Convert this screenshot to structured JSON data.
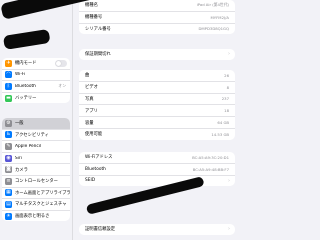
{
  "sidebar": {
    "connectivity": [
      {
        "label": "機内モード",
        "icon": "airplane-icon",
        "color": "#ff9500",
        "glyph": "✈",
        "toggle": true
      },
      {
        "label": "Wi-Fi",
        "icon": "wifi-icon",
        "color": "#007aff",
        "glyph": "◠"
      },
      {
        "label": "Bluetooth",
        "icon": "bluetooth-icon",
        "color": "#007aff",
        "glyph": "ᛒ",
        "value": "オン"
      },
      {
        "label": "バッテリー",
        "icon": "battery-icon",
        "color": "#34c759",
        "glyph": "▬"
      }
    ],
    "general": [
      {
        "label": "一般",
        "icon": "gear-icon",
        "color": "#8e8e93",
        "glyph": "⚙",
        "selected": true
      },
      {
        "label": "アクセシビリティ",
        "icon": "accessibility-icon",
        "color": "#007aff",
        "glyph": "♿"
      },
      {
        "label": "Apple Pencil",
        "icon": "pencil-icon",
        "color": "#8e8e93",
        "glyph": "✎"
      },
      {
        "label": "Siri",
        "icon": "siri-icon",
        "color": "#5856d6",
        "glyph": "◉"
      },
      {
        "label": "カメラ",
        "icon": "camera-icon",
        "color": "#8e8e93",
        "glyph": "◙"
      },
      {
        "label": "コントロールセンター",
        "icon": "control-center-icon",
        "color": "#8e8e93",
        "glyph": "≡"
      },
      {
        "label": "ホーム画面とアプリライブラリ",
        "icon": "home-screen-icon",
        "color": "#007aff",
        "glyph": "▦"
      },
      {
        "label": "マルチタスクとジェスチャ",
        "icon": "multitasking-icon",
        "color": "#007aff",
        "glyph": "▤"
      },
      {
        "label": "画面表示と明るさ",
        "icon": "brightness-icon",
        "color": "#007aff",
        "glyph": "☀"
      }
    ]
  },
  "main": {
    "device": [
      {
        "label": "機種名",
        "value": "iPad Air (第4世代)"
      },
      {
        "label": "機種番号",
        "value": "MYFM2J/A"
      },
      {
        "label": "シリアル番号",
        "value": "DMPD3D8Q1GQ"
      }
    ],
    "coverage": {
      "label": "保証期間切れ"
    },
    "stats": [
      {
        "label": "曲",
        "value": "26"
      },
      {
        "label": "ビデオ",
        "value": "8"
      },
      {
        "label": "写真",
        "value": "237"
      },
      {
        "label": "アプリ",
        "value": "18"
      },
      {
        "label": "容量",
        "value": "64 GB"
      },
      {
        "label": "使用可能",
        "value": "14.53 GB"
      }
    ],
    "network": [
      {
        "label": "Wi-Fiアドレス",
        "value": "BC:A5:A9:3C:20:D1"
      },
      {
        "label": "Bluetooth",
        "value": "BC:A5:A9:48:BB:F7"
      },
      {
        "label": "SEID",
        "value": ""
      }
    ],
    "certificate": {
      "label": "証明書信頼設定"
    }
  }
}
